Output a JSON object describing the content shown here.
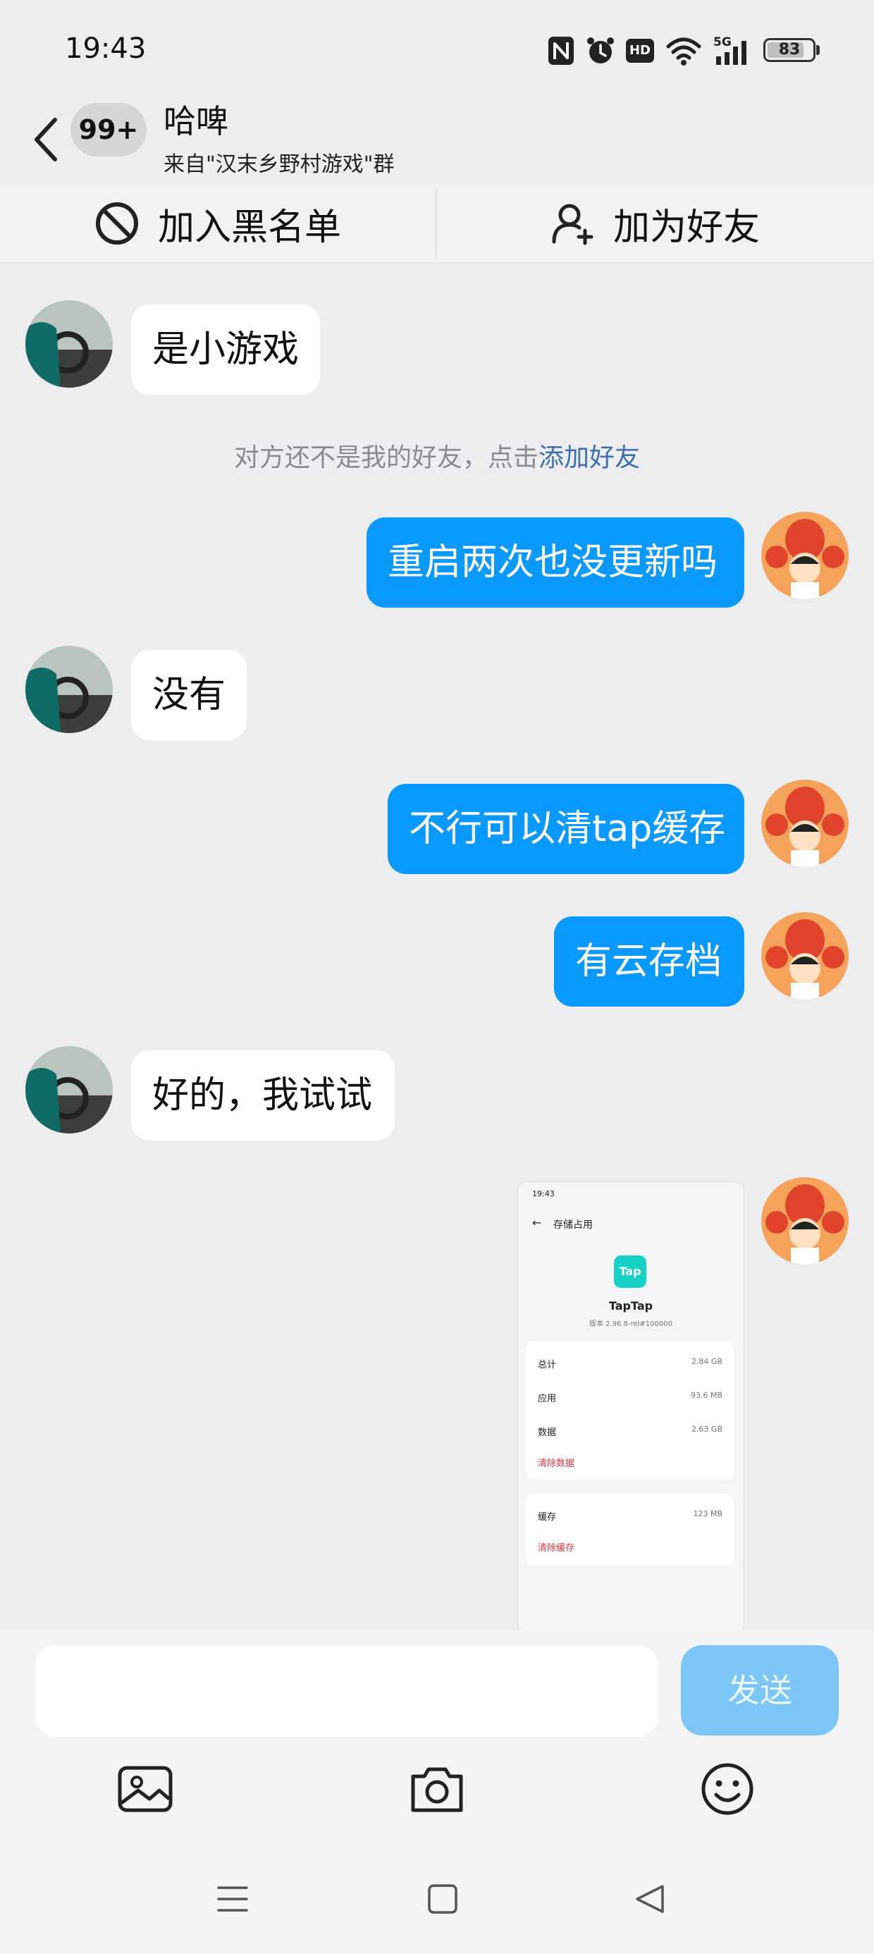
{
  "status_bar": {
    "time": "19:43",
    "icons": [
      "nfc-icon",
      "alarm-icon",
      "hd-icon",
      "wifi-icon",
      "signal-5g-icon"
    ],
    "network_label": "5G",
    "hd_label": "HD",
    "battery": {
      "label": "83",
      "level": 0.83
    }
  },
  "header": {
    "unread_badge": "99+",
    "contact_name": "哈啤",
    "subtitle": "来自\"汉末乡野村游戏\"群"
  },
  "actions": {
    "block_label": "加入黑名单",
    "add_friend_label": "加为好友"
  },
  "system_notice": {
    "text": "对方还不是我的好友，点击",
    "link": "添加好友"
  },
  "messages": [
    {
      "direction": "in",
      "text": "是小游戏"
    },
    {
      "direction": "out",
      "text": "重启两次也没更新吗"
    },
    {
      "direction": "in",
      "text": "没有"
    },
    {
      "direction": "out",
      "text": "不行可以清tap缓存"
    },
    {
      "direction": "out",
      "text": "有云存档"
    },
    {
      "direction": "in",
      "text": "好的，我试试"
    },
    {
      "direction": "out",
      "type": "image"
    }
  ],
  "thumbnail": {
    "time": "19:43",
    "title": "存储占用",
    "app_icon_text": "Tap",
    "app_name": "TapTap",
    "version": "版本 2.96.8-rel#100000",
    "total_label": "总计",
    "total_value": "2.84 GB",
    "app_label": "应用",
    "app_value": "93.6 MB",
    "data_label": "数据",
    "data_value": "2.63 GB",
    "clear_data": "清除数据",
    "cache_label": "缓存",
    "cache_value": "123 MB",
    "clear_cache": "清除缓存"
  },
  "input": {
    "placeholder": "",
    "send_label": "发送"
  },
  "toolbar_icons": [
    "image-icon",
    "camera-icon",
    "emoji-icon"
  ],
  "nav_icons": [
    "recent-apps-icon",
    "home-icon",
    "back-nav-icon"
  ],
  "colors": {
    "outgoing_bubble": "#0a99ff",
    "incoming_bubble": "#ffffff",
    "send_button": "#7cc6f7",
    "link": "#3c6fb0",
    "background": "#ededf0"
  }
}
